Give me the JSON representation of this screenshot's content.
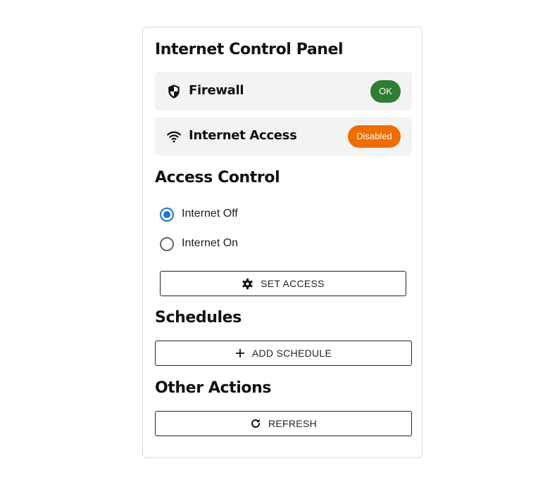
{
  "panel": {
    "title": "Internet Control Panel"
  },
  "status": [
    {
      "label": "Firewall",
      "icon": "shield-icon",
      "badge": "OK",
      "badge_color": "#2e7d32"
    },
    {
      "label": "Internet Access",
      "icon": "wifi-icon",
      "badge": "Disabled",
      "badge_color": "#ef6c00"
    }
  ],
  "access_control": {
    "heading": "Access Control",
    "options": [
      {
        "label": "Internet Off",
        "checked": true
      },
      {
        "label": "Internet On",
        "checked": false
      }
    ],
    "set_access_label": "SET ACCESS",
    "set_access_icon": "gear-icon"
  },
  "schedules": {
    "heading": "Schedules",
    "add_label": "ADD SCHEDULE",
    "add_icon": "plus-icon"
  },
  "other_actions": {
    "heading": "Other Actions",
    "refresh_label": "REFRESH",
    "refresh_icon": "refresh-icon"
  },
  "colors": {
    "accent": "#1976d2",
    "ok": "#2e7d32",
    "warning": "#ef6c00"
  }
}
